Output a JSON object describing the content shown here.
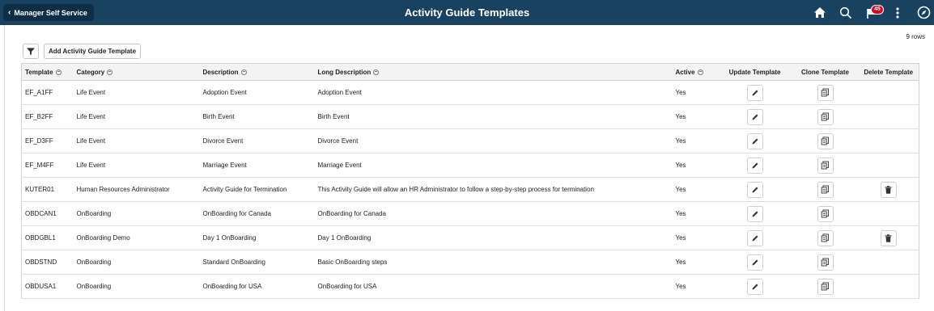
{
  "header": {
    "back_label": "Manager Self Service",
    "title": "Activity Guide Templates",
    "notification_count": "45",
    "icons": [
      "home-icon",
      "search-icon",
      "notification-flag-icon",
      "more-options-icon",
      "navbar-compass-icon"
    ]
  },
  "grid": {
    "row_count": "9 rows",
    "add_button_label": "Add Activity Guide Template",
    "columns": {
      "template": "Template",
      "category": "Category",
      "description": "Description",
      "long_description": "Long Description",
      "active": "Active",
      "update": "Update Template",
      "clone": "Clone Template",
      "delete": "Delete Template"
    },
    "rows": [
      {
        "template": "EF_A1FF",
        "category": "Life Event",
        "description": "Adoption Event",
        "long_description": "Adoption Event",
        "active": "Yes",
        "deletable": false
      },
      {
        "template": "EF_B2FF",
        "category": "Life Event",
        "description": "Birth Event",
        "long_description": "Birth Event",
        "active": "Yes",
        "deletable": false
      },
      {
        "template": "EF_D3FF",
        "category": "Life Event",
        "description": "Divorce Event",
        "long_description": "Divorce Event",
        "active": "Yes",
        "deletable": false
      },
      {
        "template": "EF_M4FF",
        "category": "Life Event",
        "description": "Marriage Event",
        "long_description": "Marriage Event",
        "active": "Yes",
        "deletable": false
      },
      {
        "template": "KUTER01",
        "category": "Human Resources Administrator",
        "description": "Activity Guide for Termination",
        "long_description": "This Activity Guide will allow an HR Administrator to follow a step-by-step process for termination",
        "active": "Yes",
        "deletable": true
      },
      {
        "template": "OBDCAN1",
        "category": "OnBoarding",
        "description": "OnBoarding for Canada",
        "long_description": "OnBoarding for Canada",
        "active": "Yes",
        "deletable": false
      },
      {
        "template": "OBDGBL1",
        "category": "OnBoarding Demo",
        "description": "Day 1 OnBoarding",
        "long_description": "Day 1 OnBoarding",
        "active": "Yes",
        "deletable": true
      },
      {
        "template": "OBDSTND",
        "category": "OnBoarding",
        "description": "Standard OnBoarding",
        "long_description": "Basic OnBoarding steps",
        "active": "Yes",
        "deletable": false
      },
      {
        "template": "OBDUSA1",
        "category": "OnBoarding",
        "description": "OnBoarding for USA",
        "long_description": "OnBoarding for USA",
        "active": "Yes",
        "deletable": false
      }
    ]
  },
  "colors": {
    "header_bg": "#194260",
    "back_button_bg": "#0e2d47",
    "badge_red": "#e0001b",
    "grid_header_bg": "#f3f3f3"
  }
}
